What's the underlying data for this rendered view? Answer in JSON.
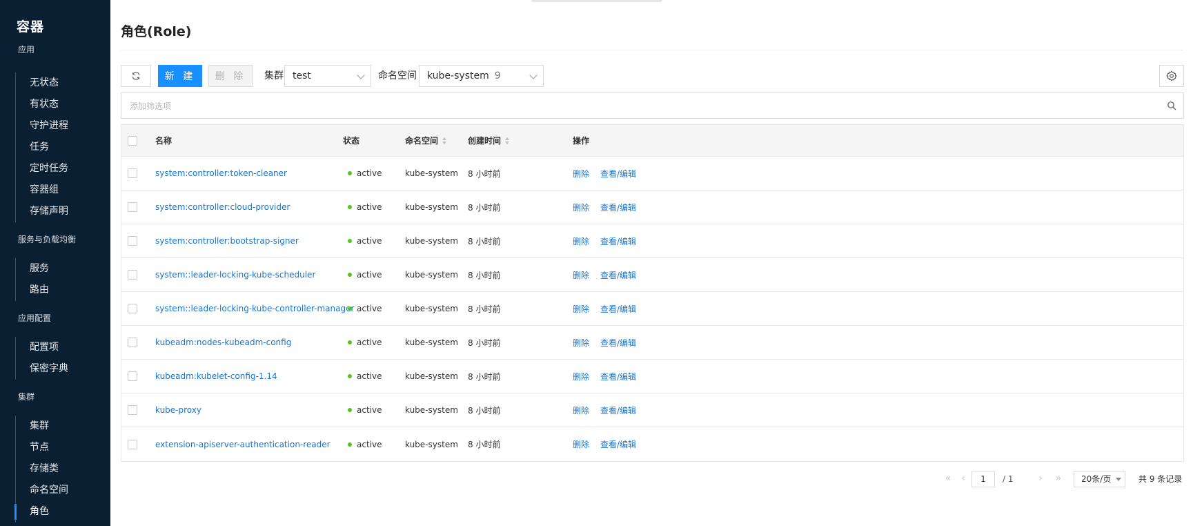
{
  "sidebar": {
    "title": "容器",
    "groups": [
      {
        "title": "应用",
        "items": [
          "无状态",
          "有状态",
          "守护进程",
          "任务",
          "定时任务",
          "容器组",
          "存储声明"
        ]
      },
      {
        "title": "服务与负载均衡",
        "items": [
          "服务",
          "路由"
        ]
      },
      {
        "title": "应用配置",
        "items": [
          "配置项",
          "保密字典"
        ]
      },
      {
        "title": "集群",
        "items": [
          "集群",
          "节点",
          "存储类",
          "命名空间",
          "角色"
        ]
      }
    ],
    "active_item": "角色"
  },
  "page": {
    "title": "角色(Role)"
  },
  "toolbar": {
    "new_label": "新 建",
    "delete_label": "删 除",
    "cluster_label": "集群",
    "cluster_value": "test",
    "namespace_label": "命名空间",
    "namespace_value": "kube-system",
    "namespace_count": "9"
  },
  "filter": {
    "placeholder": "添加筛选项"
  },
  "table": {
    "columns": {
      "name": "名称",
      "status": "状态",
      "namespace": "命名空间",
      "created": "创建时间",
      "actions": "操作"
    },
    "rows": [
      {
        "name": "system:controller:token-cleaner",
        "status": "active",
        "namespace": "kube-system",
        "created": "8 小时前"
      },
      {
        "name": "system:controller:cloud-provider",
        "status": "active",
        "namespace": "kube-system",
        "created": "8 小时前"
      },
      {
        "name": "system:controller:bootstrap-signer",
        "status": "active",
        "namespace": "kube-system",
        "created": "8 小时前"
      },
      {
        "name": "system::leader-locking-kube-scheduler",
        "status": "active",
        "namespace": "kube-system",
        "created": "8 小时前"
      },
      {
        "name": "system::leader-locking-kube-controller-manager",
        "status": "active",
        "namespace": "kube-system",
        "created": "8 小时前"
      },
      {
        "name": "kubeadm:nodes-kubeadm-config",
        "status": "active",
        "namespace": "kube-system",
        "created": "8 小时前"
      },
      {
        "name": "kubeadm:kubelet-config-1.14",
        "status": "active",
        "namespace": "kube-system",
        "created": "8 小时前"
      },
      {
        "name": "kube-proxy",
        "status": "active",
        "namespace": "kube-system",
        "created": "8 小时前"
      },
      {
        "name": "extension-apiserver-authentication-reader",
        "status": "active",
        "namespace": "kube-system",
        "created": "8 小时前"
      }
    ],
    "action_delete": "删除",
    "action_edit": "查看/编辑"
  },
  "pagination": {
    "current_page": "1",
    "total_pages": "/ 1",
    "page_size": "20条/页",
    "summary": "共 9 条记录"
  },
  "colors": {
    "sidebar_bg": "#0b1f33",
    "primary": "#1890ff",
    "link": "#1675d1",
    "status_active": "#52c41a"
  }
}
